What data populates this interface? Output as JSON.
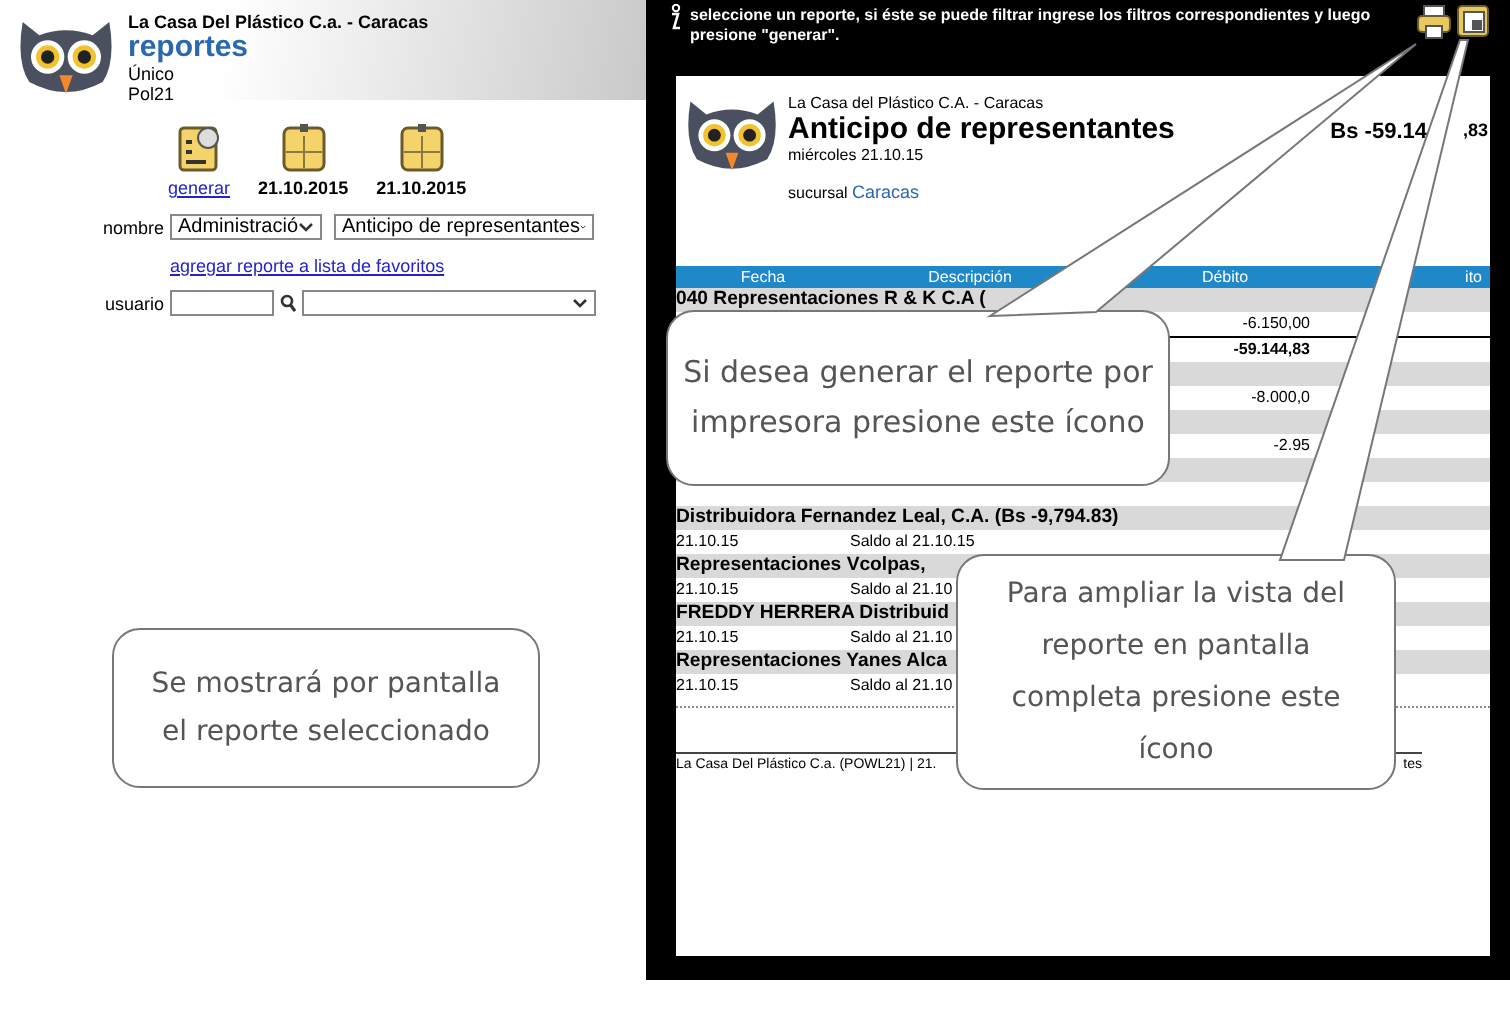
{
  "app_header": {
    "company": "La Casa Del Plástico C.a. - Caracas",
    "title": "reportes",
    "lines": [
      "Único",
      "Pol21"
    ]
  },
  "toolbar": {
    "generate": "generar",
    "dates": [
      "21.10.2015",
      "21.10.2015"
    ]
  },
  "form": {
    "name_label": "nombre",
    "category": "Administració",
    "report": "Anticipo de representantes",
    "favorites_link": "agregar reporte a lista de favoritos",
    "user_label": "usuario"
  },
  "instructions": "seleccione un reporte, si éste se puede filtrar ingrese los filtros correspondientes y luego presione \"generar\".",
  "report": {
    "company": "La Casa del Plástico C.A. - Caracas",
    "title": "Anticipo de representantes",
    "date": "miércoles 21.10.15",
    "branch_label": "sucursal",
    "branch": "Caracas",
    "total": "Bs -59.14",
    "total_tail": ",83",
    "columns": [
      "Fecha",
      "Descripción",
      "Débito",
      "ito"
    ],
    "rows": [
      {
        "kind": "group",
        "text": "040 Representaciones R & K C.A ("
      },
      {
        "kind": "detail",
        "debit": "-6.150,00"
      },
      {
        "kind": "total",
        "debit": "-59.144,83"
      },
      {
        "kind": "band"
      },
      {
        "kind": "detail",
        "debit": "-8.000,0"
      },
      {
        "kind": "band"
      },
      {
        "kind": "detail",
        "debit": "-2.95"
      },
      {
        "kind": "band"
      },
      {
        "kind": "detail"
      },
      {
        "kind": "group",
        "text": "Distribuidora Fernandez Leal, C.A. (Bs -9,794.83)"
      },
      {
        "kind": "detail",
        "date": "21.10.15",
        "description": "Saldo al 21.10.15"
      },
      {
        "kind": "group",
        "text": "Representaciones Vcolpas,"
      },
      {
        "kind": "detail",
        "date": "21.10.15",
        "description": "Saldo al 21.10"
      },
      {
        "kind": "group",
        "text": "FREDDY HERRERA Distribuid"
      },
      {
        "kind": "detail",
        "date": "21.10.15",
        "description": "Saldo al 21.10"
      },
      {
        "kind": "group",
        "text": "Representaciones Yanes Alca"
      },
      {
        "kind": "detail",
        "date": "21.10.15",
        "description": "Saldo al 21.10"
      }
    ],
    "footer": "La Casa Del Plástico C.a. (POWL21) | 21.",
    "footer_tail": "tes"
  },
  "callouts": [
    {
      "kind": "plain",
      "lines": [
        "Se mostrará por pantalla",
        "el reporte seleccionado"
      ]
    },
    {
      "kind": "printer",
      "lines": [
        "Si desea generar el reporte por",
        "impresora presione este ícono"
      ]
    },
    {
      "kind": "fullscreen",
      "lines": [
        "Para ampliar la vista del",
        "reporte en pantalla",
        "completa presione este",
        "ícono"
      ]
    }
  ]
}
